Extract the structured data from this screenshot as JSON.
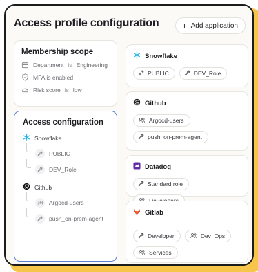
{
  "header": {
    "title": "Access profile configuration",
    "add_button": "Add application"
  },
  "membership": {
    "title": "Membership scope",
    "rows": [
      {
        "label": "Department",
        "connector": "is",
        "value": "Engineering",
        "icon": "building-icon"
      },
      {
        "label": "MFA is enabled",
        "icon": "shield-icon"
      },
      {
        "label": "Risk score",
        "connector": "is",
        "value": "low",
        "icon": "gauge-icon"
      }
    ]
  },
  "access": {
    "title": "Access configuration",
    "apps": [
      {
        "name": "Snowflake",
        "icon": "snowflake-icon",
        "items": [
          "PUBLIC",
          "DEV_Role"
        ]
      },
      {
        "name": "Github",
        "icon": "github-icon",
        "items": [
          "Argocd-users",
          "push_on-prem-agent"
        ]
      }
    ]
  },
  "apps": [
    {
      "name": "Snowflake",
      "icon": "snowflake-icon",
      "chips": [
        {
          "label": "PUBLIC",
          "icon": "wrench-icon"
        },
        {
          "label": "DEV_Role",
          "icon": "wrench-icon"
        }
      ]
    },
    {
      "name": "Github",
      "icon": "github-icon",
      "chips": [
        {
          "label": "Argocd-users",
          "icon": "users-icon"
        },
        {
          "label": "push_on-prem-agent",
          "icon": "wrench-icon"
        }
      ]
    },
    {
      "name": "Datadog",
      "icon": "datadog-icon",
      "chips": [
        {
          "label": "Standard role",
          "icon": "wrench-icon"
        },
        {
          "label": "Developers",
          "icon": "users-icon"
        }
      ]
    },
    {
      "name": "Gitlab",
      "icon": "gitlab-icon",
      "chips": [
        {
          "label": "Developer",
          "icon": "wrench-icon"
        },
        {
          "label": "Dev_Ops",
          "icon": "users-icon"
        },
        {
          "label": "Services",
          "icon": "users-icon"
        }
      ]
    }
  ],
  "colors": {
    "accent_yellow": "#f6c64b",
    "selected_border": "#5b7fd6",
    "snowflake": "#29b5e8",
    "gitlab": "#e24329",
    "datadog": "#632ca6"
  }
}
